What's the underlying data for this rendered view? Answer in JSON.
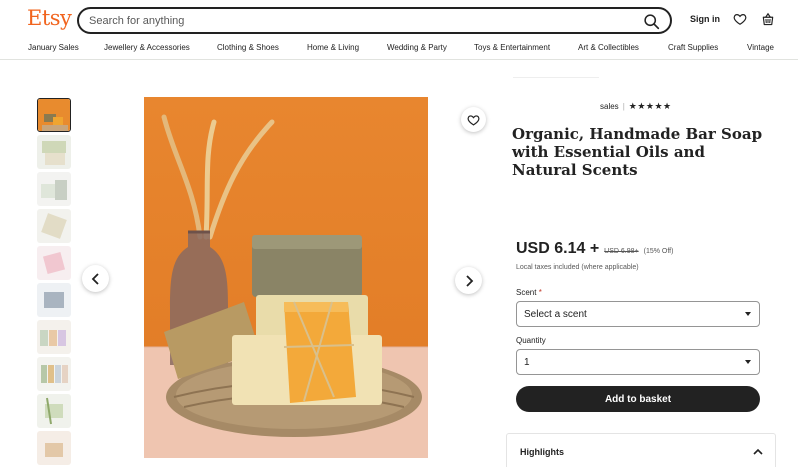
{
  "header": {
    "logo": "Etsy",
    "search_placeholder": "Search for anything",
    "signin_label": "Sign in"
  },
  "nav": {
    "items": [
      "January Sales",
      "Jewellery & Accessories",
      "Clothing & Shoes",
      "Home & Living",
      "Wedding & Party",
      "Toys & Entertainment",
      "Art & Collectibles",
      "Craft Supplies",
      "Vintage"
    ]
  },
  "product": {
    "sales_label": "sales",
    "rating_stars": "★★★★★",
    "title": "Organic, Handmade Bar Soap with Essential Oils and Natural Scents",
    "price": "USD 6.14",
    "price_plus": "+",
    "old_price": "USD 6.98+",
    "discount": "(15% Off)",
    "tax_note": "Local taxes included (where applicable)"
  },
  "form": {
    "scent_label": "Scent",
    "scent_required": "*",
    "scent_value": "Select a scent",
    "quantity_label": "Quantity",
    "quantity_value": "1",
    "add_button": "Add to basket"
  },
  "highlights": {
    "label": "Highlights"
  },
  "colors": {
    "brand": "#f1641e",
    "button_dark": "#222222"
  }
}
